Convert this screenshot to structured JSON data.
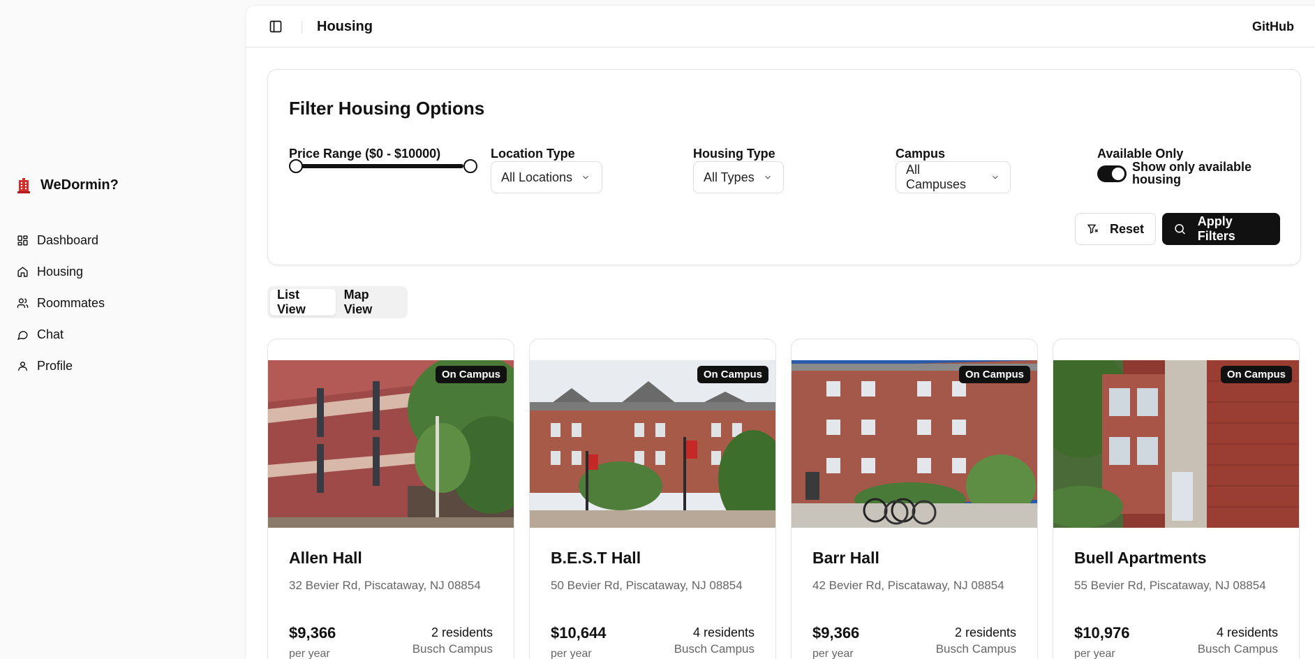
{
  "sidebar": {
    "brand": "WeDormin?",
    "items": [
      {
        "label": "Dashboard",
        "icon": "dashboard-icon"
      },
      {
        "label": "Housing",
        "icon": "home-icon"
      },
      {
        "label": "Roommates",
        "icon": "users-icon"
      },
      {
        "label": "Chat",
        "icon": "chat-icon"
      },
      {
        "label": "Profile",
        "icon": "user-icon"
      }
    ]
  },
  "header": {
    "title": "Housing",
    "github": "GitHub"
  },
  "filters": {
    "title": "Filter Housing Options",
    "price_label": "Price Range ($0 - $10000)",
    "price_min": 0,
    "price_max": 10000,
    "location_label": "Location Type",
    "location_value": "All Locations",
    "housing_label": "Housing Type",
    "housing_value": "All Types",
    "campus_label": "Campus",
    "campus_value": "All Campuses",
    "available_label": "Available Only",
    "available_toggle_label": "Show only available housing",
    "available_on": true,
    "reset_label": "Reset",
    "apply_label": "Apply Filters"
  },
  "views": {
    "list": "List View",
    "map": "Map View",
    "active": "list"
  },
  "listings": [
    {
      "badge": "On Campus",
      "name": "Allen Hall",
      "address": "32 Bevier Rd, Piscataway, NJ 08854",
      "price": "$9,366",
      "period": "per year",
      "residents": "2 residents",
      "campus": "Busch Campus"
    },
    {
      "badge": "On Campus",
      "name": "B.E.S.T Hall",
      "address": "50 Bevier Rd, Piscataway, NJ 08854",
      "price": "$10,644",
      "period": "per year",
      "residents": "4 residents",
      "campus": "Busch Campus"
    },
    {
      "badge": "On Campus",
      "name": "Barr Hall",
      "address": "42 Bevier Rd, Piscataway, NJ 08854",
      "price": "$9,366",
      "period": "per year",
      "residents": "2 residents",
      "campus": "Busch Campus"
    },
    {
      "badge": "On Campus",
      "name": "Buell Apartments",
      "address": "55 Bevier Rd, Piscataway, NJ 08854",
      "price": "$10,976",
      "period": "per year",
      "residents": "4 residents",
      "campus": "Busch Campus"
    }
  ],
  "colors": {
    "brand": "#d32f2f",
    "primary": "#111111",
    "muted": "#666666"
  }
}
